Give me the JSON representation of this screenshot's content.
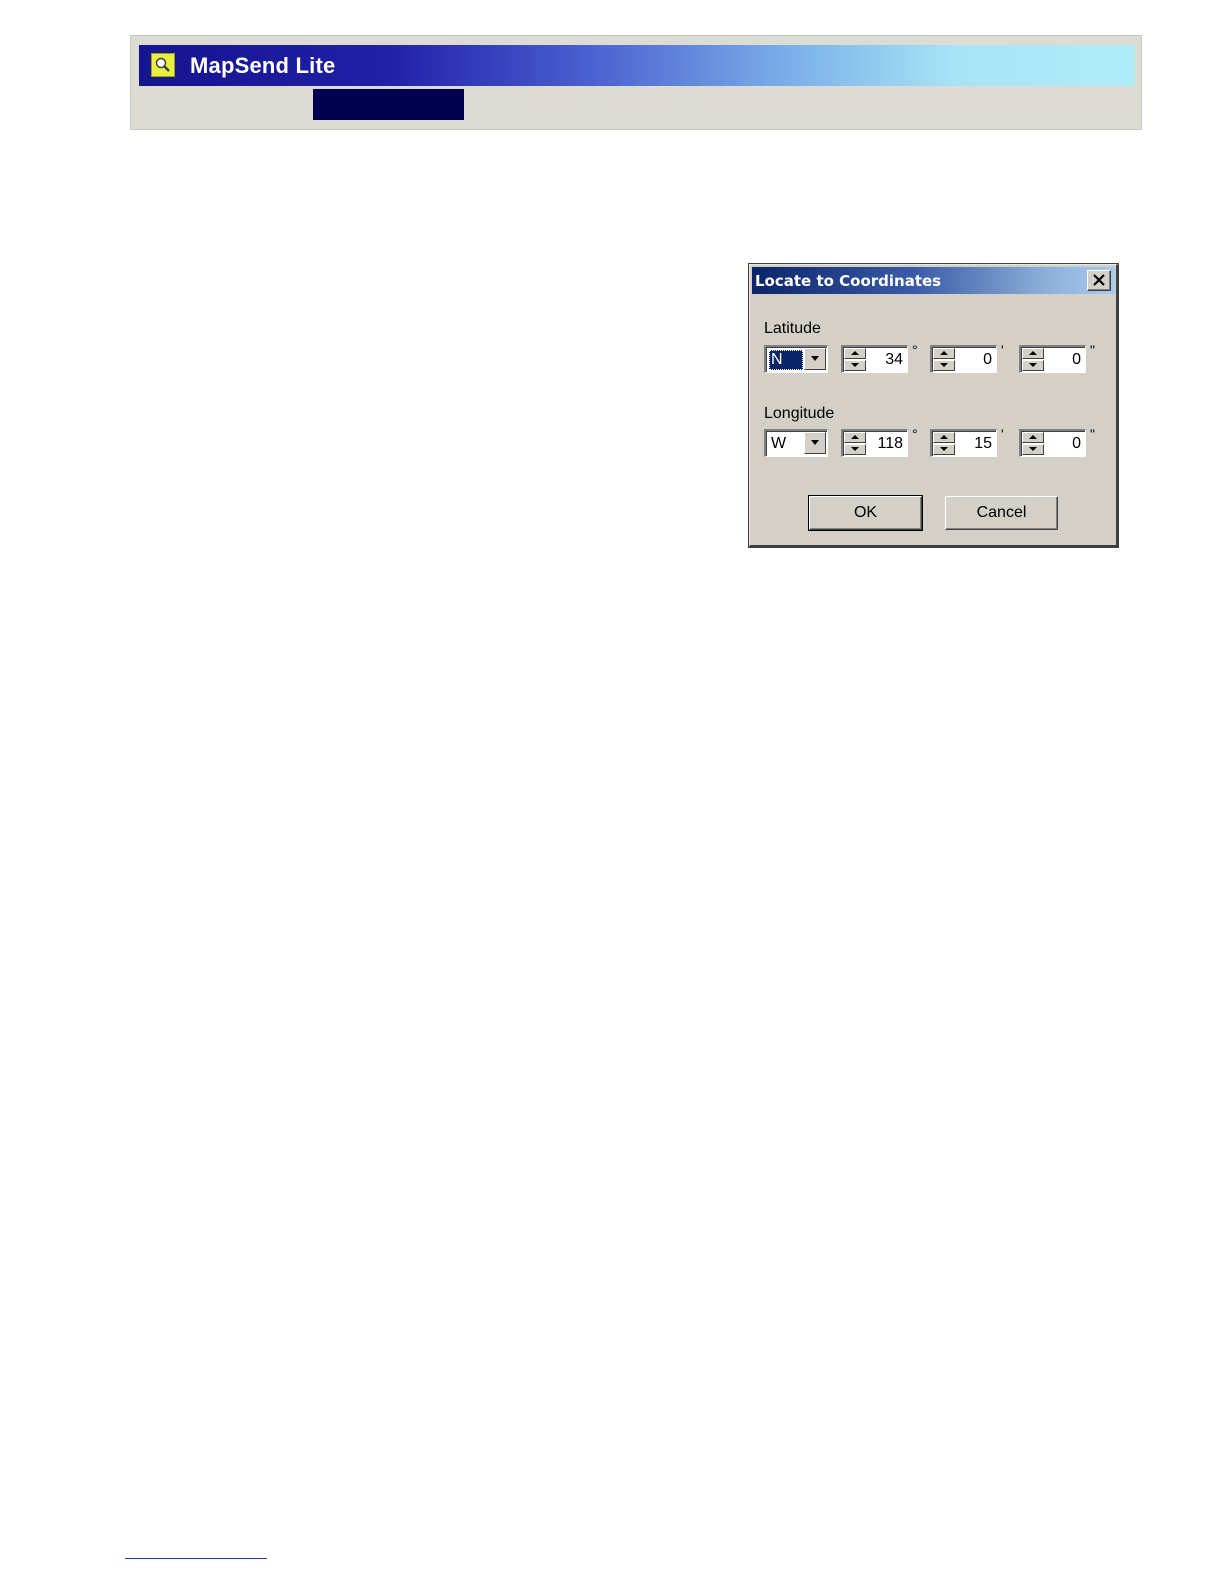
{
  "header": {
    "title": "MapSend Lite",
    "icon": "magnifier-icon",
    "gradient_start": "#15158f",
    "gradient_end": "#b0ecf8",
    "tab_color": "#000050"
  },
  "dialog": {
    "title": "Locate to Coordinates",
    "close_icon": "close-icon",
    "latitude": {
      "label": "Latitude",
      "hemisphere": "N",
      "degrees": "34",
      "degree_mark": "°",
      "minutes": "0",
      "minute_mark": "'",
      "seconds": "0",
      "second_mark": "\""
    },
    "longitude": {
      "label": "Longitude",
      "hemisphere": "W",
      "degrees": "118",
      "degree_mark": "°",
      "minutes": "15",
      "minute_mark": "'",
      "seconds": "0",
      "second_mark": "\""
    },
    "ok_label": "OK",
    "cancel_label": "Cancel",
    "titlebar_color": "#0a246a",
    "face_color": "#d4d0c8"
  }
}
